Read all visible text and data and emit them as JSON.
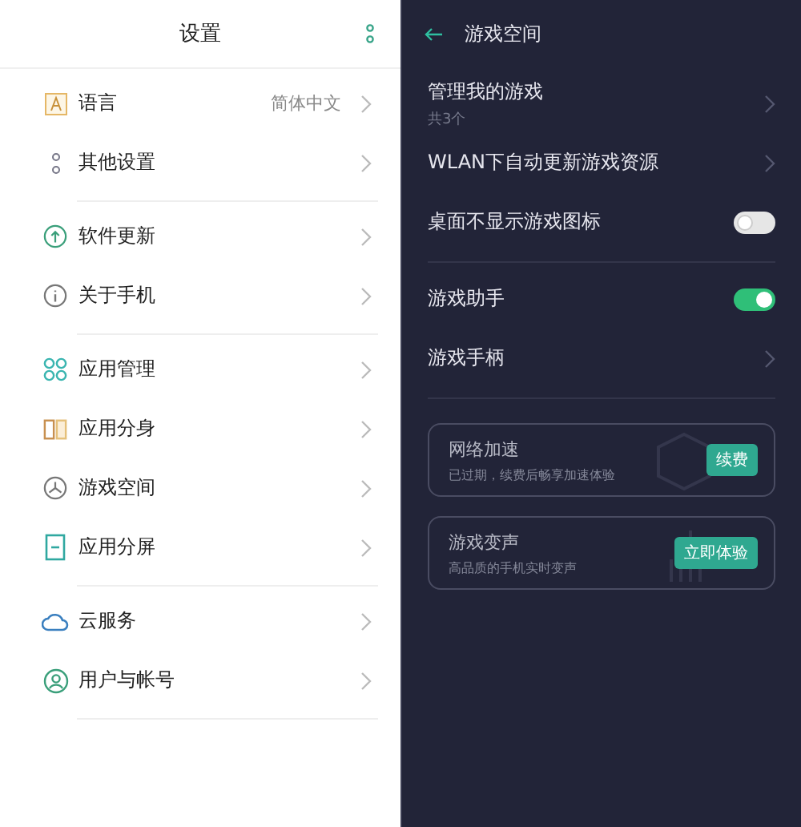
{
  "settings": {
    "title": "设置",
    "groups": [
      {
        "items": [
          {
            "label": "语言",
            "value": "简体中文"
          },
          {
            "label": "其他设置"
          }
        ]
      },
      {
        "items": [
          {
            "label": "软件更新"
          },
          {
            "label": "关于手机"
          }
        ]
      },
      {
        "items": [
          {
            "label": "应用管理"
          },
          {
            "label": "应用分身"
          },
          {
            "label": "游戏空间"
          },
          {
            "label": "应用分屏"
          }
        ]
      },
      {
        "items": [
          {
            "label": "云服务"
          },
          {
            "label": "用户与帐号"
          }
        ]
      }
    ]
  },
  "game_space": {
    "title": "游戏空间",
    "groups": [
      {
        "items": [
          {
            "kind": "link",
            "label": "管理我的游戏",
            "subtitle": "共3个"
          },
          {
            "kind": "link",
            "label": "WLAN下自动更新游戏资源"
          },
          {
            "kind": "toggle",
            "label": "桌面不显示游戏图标",
            "on": false
          }
        ]
      },
      {
        "items": [
          {
            "kind": "toggle",
            "label": "游戏助手",
            "on": true
          },
          {
            "kind": "link",
            "label": "游戏手柄"
          }
        ]
      }
    ],
    "cards": [
      {
        "title": "网络加速",
        "subtitle": "已过期，续费后畅享加速体验",
        "button": "续费"
      },
      {
        "title": "游戏变声",
        "subtitle": "高品质的手机实时变声",
        "button": "立即体验"
      }
    ]
  }
}
